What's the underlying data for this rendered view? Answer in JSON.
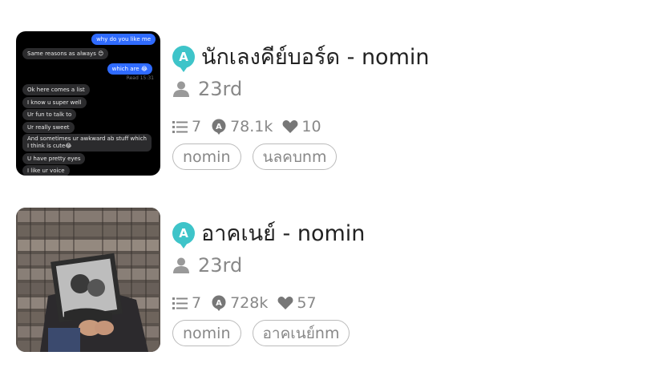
{
  "stories": [
    {
      "title": "นักเลงคีย์บอร์ด - nomin",
      "author": "23rd",
      "stats": {
        "parts": "7",
        "reads": "78.1k",
        "votes": "10"
      },
      "tags": [
        "nomin",
        "นลคบnm"
      ],
      "cover_chat": {
        "out_1": "why do you like me",
        "in_1": "Same reasons as always 😊",
        "out_2": "which are 😂",
        "read": "Read 15:31",
        "in_list": [
          "Ok here comes a list",
          "I know u super well",
          "Ur fun to talk to",
          "Ur really sweet",
          "And sometimes ur awkward ab stuff which",
          "I think is cute😂",
          "U have pretty eyes",
          "I like ur voice"
        ]
      }
    },
    {
      "title": "อาคเนย์ - nomin",
      "author": "23rd",
      "stats": {
        "parts": "7",
        "reads": "728k",
        "votes": "57"
      },
      "tags": [
        "nomin",
        "อาคเนย์nm"
      ]
    }
  ],
  "colors": {
    "badge": "#3ec4c9",
    "muted": "#888888",
    "chat_out": "#2f6bff",
    "chat_in": "#2b2b2d"
  },
  "icons": [
    "app-badge-icon",
    "person-icon",
    "list-icon",
    "reads-icon",
    "heart-icon"
  ]
}
